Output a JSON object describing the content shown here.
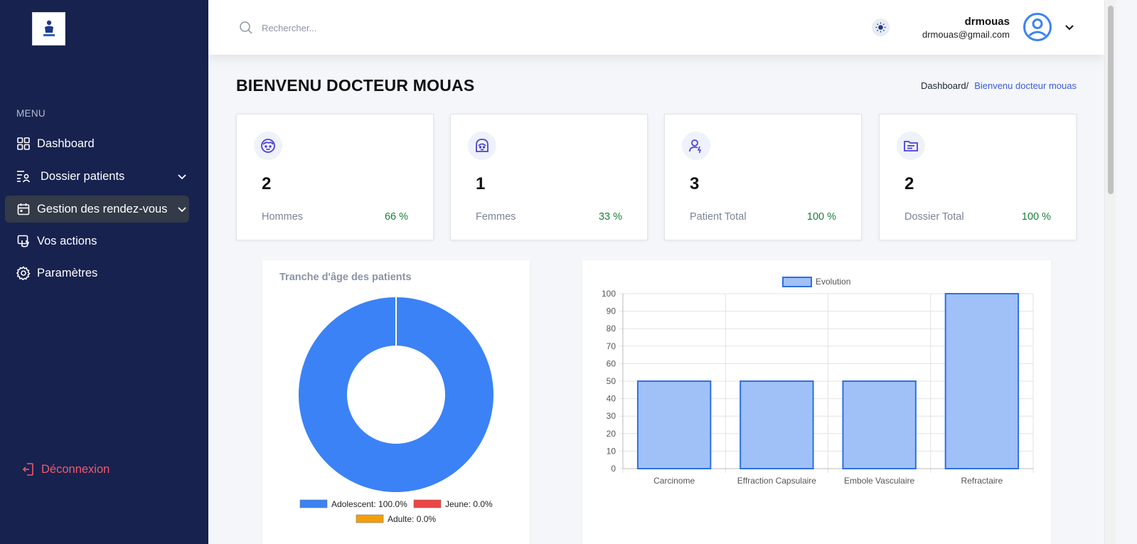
{
  "sidebar": {
    "menu_heading": "MENU",
    "items": [
      {
        "label": "Dashboard",
        "icon": "grid-icon"
      },
      {
        "label": "Dossier patients",
        "icon": "list-user-icon"
      },
      {
        "label": "Gestion des rendez-vous",
        "icon": "calendar-icon"
      },
      {
        "label": "Vos actions",
        "icon": "hand-icon"
      },
      {
        "label": "Paramètres",
        "icon": "gear-icon"
      }
    ],
    "logout_label": "Déconnexion"
  },
  "header": {
    "search_placeholder": "Rechercher...",
    "user_name": "drmouas",
    "user_email": "drmouas@gmail.com"
  },
  "page": {
    "title": "BIENVENU DOCTEUR MOUAS",
    "breadcrumb_root": "Dashboard/",
    "breadcrumb_current": "Bienvenu docteur mouas"
  },
  "stats": [
    {
      "value": "2",
      "label": "Hommes",
      "percent": "66 %",
      "icon": "male-face-icon"
    },
    {
      "value": "1",
      "label": "Femmes",
      "percent": "33 %",
      "icon": "female-face-icon"
    },
    {
      "value": "3",
      "label": "Patient Total",
      "percent": "100 %",
      "icon": "user-icon"
    },
    {
      "value": "2",
      "label": "Dossier Total",
      "percent": "100 %",
      "icon": "folder-icon"
    }
  ],
  "colors": {
    "sidebar_bg": "#17224f",
    "accent": "#4f3fd8",
    "positive": "#188038",
    "logout": "#f05a6a",
    "donut_blue": "#3b82f6",
    "donut_red": "#ef4444",
    "donut_orange": "#f59e0b",
    "bar_fill": "#9fc1f8",
    "bar_stroke": "#2f6fe0"
  },
  "chart_data": [
    {
      "type": "pie",
      "title": "Tranche d'âge des patients",
      "categories": [
        "Adolescent",
        "Jeune",
        "Adulte"
      ],
      "values": [
        100.0,
        0.0,
        0.0
      ],
      "legend_labels": [
        "Adolescent: 100.0%",
        "Jeune: 0.0%",
        "Adulte: 0.0%"
      ],
      "legend": "bottom"
    },
    {
      "type": "bar",
      "categories": [
        "Carcinome",
        "Effraction Capsulaire",
        "Embole Vasculaire",
        "Refractaire"
      ],
      "series": [
        {
          "name": "Evolution",
          "values": [
            50,
            50,
            50,
            100
          ]
        }
      ],
      "ylim": [
        0,
        100
      ],
      "yticks": [
        0,
        10,
        20,
        30,
        40,
        50,
        60,
        70,
        80,
        90,
        100
      ],
      "grid": true,
      "legend": "top"
    }
  ]
}
